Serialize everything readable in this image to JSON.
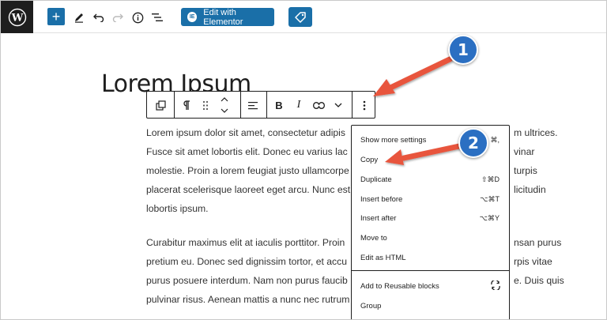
{
  "toolbar": {
    "add_label": "+",
    "elementor_label": "Edit with Elementor",
    "elementor_badge": "IE"
  },
  "post": {
    "title": "Lorem Ipsum",
    "paragraph1": [
      "Lorem ipsum dolor sit amet, consectetur adipis",
      "Fusce sit amet lobortis elit. Donec eu varius lac",
      "molestie. Proin a lorem feugiat justo ullamcorpe",
      "placerat scelerisque laoreet eget arcu. Nunc est",
      "lobortis ipsum."
    ],
    "paragraph1_right": [
      "m ultrices.",
      "vinar",
      "turpis",
      "licitudin"
    ],
    "paragraph2": [
      "Curabitur maximus elit at iaculis porttitor. Proin",
      "pretium eu. Donec sed dignissim tortor, et accu",
      "purus posuere interdum. Nam non purus faucib",
      "pulvinar risus. Aenean mattis a nunc nec rutrum"
    ],
    "paragraph2_right": [
      "nsan purus",
      "rpis vitae",
      "e. Duis quis",
      ""
    ]
  },
  "menu": {
    "items": [
      {
        "label": "Show more settings",
        "shortcut": "⌘,"
      },
      {
        "label": "Copy",
        "shortcut": ""
      },
      {
        "label": "Duplicate",
        "shortcut": "⇧⌘D"
      },
      {
        "label": "Insert before",
        "shortcut": "⌥⌘T"
      },
      {
        "label": "Insert after",
        "shortcut": "⌥⌘Y"
      },
      {
        "label": "Move to",
        "shortcut": ""
      },
      {
        "label": "Edit as HTML",
        "shortcut": ""
      },
      {
        "label": "Add to Reusable blocks",
        "shortcut": ""
      },
      {
        "label": "Group",
        "shortcut": ""
      }
    ]
  },
  "callouts": {
    "step1": "1",
    "step2": "2"
  },
  "colors": {
    "accent": "#1a6fa8",
    "arrow": "#e8553e",
    "callout": "#2b6fc2"
  }
}
